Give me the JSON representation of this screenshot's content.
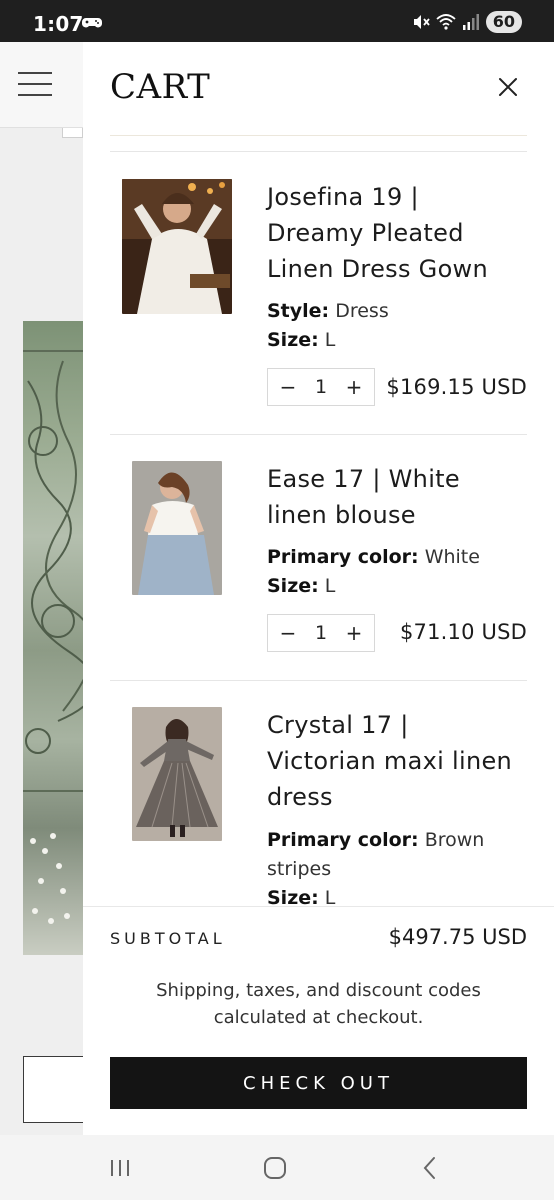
{
  "status_bar": {
    "time": "1:07",
    "battery": "60",
    "icons": [
      "game-controller-icon",
      "mute-icon",
      "wifi-icon",
      "signal-icon"
    ]
  },
  "background_page": {
    "icons": [
      "hamburger-menu-icon"
    ]
  },
  "cart": {
    "title": "CART",
    "close_icon": "close-icon",
    "items": [
      {
        "name": "Josefina 19 | Dreamy Pleated Linen Dress Gown",
        "name_lines": [
          "Josefina 19 |",
          "Dreamy Pleated",
          "Linen Dress Gown"
        ],
        "options": [
          {
            "key": "Style:",
            "value": "Dress"
          },
          {
            "key": "Size:",
            "value": "L"
          }
        ],
        "quantity": "1",
        "price": "$169.15 USD"
      },
      {
        "name": "Ease 17 | White linen blouse",
        "name_lines": [
          "Ease 17 | White",
          "linen blouse"
        ],
        "options": [
          {
            "key": "Primary color:",
            "value": "White"
          },
          {
            "key": "Size:",
            "value": "L"
          }
        ],
        "quantity": "1",
        "price": "$71.10 USD"
      },
      {
        "name": "Crystal 17 | Victorian maxi linen dress",
        "name_lines": [
          "Crystal 17 |",
          "Victorian maxi linen",
          "dress"
        ],
        "options": [
          {
            "key": "Primary color:",
            "value": "Brown",
            "value_cont": "stripes"
          },
          {
            "key": "Size:",
            "value": "L"
          }
        ]
      }
    ],
    "qty_decrease_symbol": "−",
    "qty_increase_symbol": "+",
    "subtotal_label": "SUBTOTAL",
    "subtotal_value": "$497.75 USD",
    "shipping_note_lines": [
      "Shipping, taxes, and discount codes",
      "calculated at checkout."
    ],
    "checkout_label": "CHECK OUT"
  },
  "nav_bar": {
    "icons": [
      "recent-apps-icon",
      "home-icon",
      "back-icon"
    ]
  },
  "colors": {
    "accent": "#141414",
    "status_bar": "#1f1f1f",
    "divider": "#e6e6e6"
  }
}
